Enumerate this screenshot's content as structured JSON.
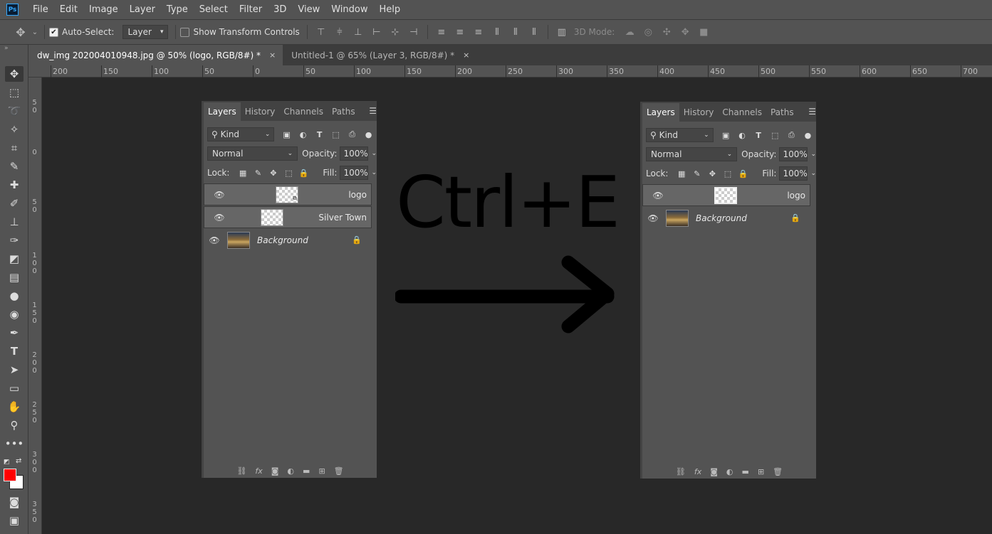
{
  "app": {
    "logo": "Ps"
  },
  "menu": [
    "File",
    "Edit",
    "Image",
    "Layer",
    "Type",
    "Select",
    "Filter",
    "3D",
    "View",
    "Window",
    "Help"
  ],
  "options": {
    "auto_select_label": "Auto-Select:",
    "auto_select_checked": true,
    "auto_select_value": "Layer",
    "show_transform_label": "Show Transform Controls",
    "show_transform_checked": false,
    "mode_3d_label": "3D Mode:"
  },
  "tabs": [
    {
      "title": "dw_img 202004010948.jpg @ 50% (logo, RGB/8#) *",
      "active": true,
      "close": "×"
    },
    {
      "title": "Untitled-1 @ 65% (Layer 3, RGB/8#) *",
      "active": false,
      "close": "×"
    }
  ],
  "ruler_top": [
    "200",
    "150",
    "100",
    "50",
    "0",
    "50",
    "100",
    "150",
    "200",
    "250",
    "300",
    "350",
    "400",
    "450",
    "500",
    "550",
    "600",
    "650",
    "700"
  ],
  "ruler_left": [
    "5\n0",
    "0",
    "5\n0",
    "1\n0\n0",
    "1\n5\n0",
    "2\n0\n0",
    "2\n5\n0",
    "3\n0\n0",
    "3\n5\n0"
  ],
  "colors": {
    "foreground": "#ff0000",
    "background": "#ffffff",
    "accent": "#31a8ff"
  },
  "canvas": {
    "shortcut_text": "Ctrl+E"
  },
  "panel_left": {
    "tabs": [
      "Layers",
      "History",
      "Channels",
      "Paths"
    ],
    "kind": "Kind",
    "blend_mode": "Normal",
    "opacity_label": "Opacity:",
    "opacity": "100%",
    "lock_label": "Lock:",
    "fill_label": "Fill:",
    "fill": "100%",
    "layers": [
      {
        "name": "logo",
        "selected": true,
        "thumb": "transparent-smart",
        "italic": false,
        "locked": false
      },
      {
        "name": "Silver Town",
        "selected": true,
        "thumb": "transparent",
        "italic": false,
        "locked": false
      },
      {
        "name": "Background",
        "selected": false,
        "thumb": "photo",
        "italic": true,
        "locked": true
      }
    ]
  },
  "panel_right": {
    "tabs": [
      "Layers",
      "History",
      "Channels",
      "Paths"
    ],
    "kind": "Kind",
    "blend_mode": "Normal",
    "opacity_label": "Opacity:",
    "opacity": "100%",
    "lock_label": "Lock:",
    "fill_label": "Fill:",
    "fill": "100%",
    "layers": [
      {
        "name": "logo",
        "selected": true,
        "thumb": "transparent-outlined",
        "italic": false,
        "locked": false
      },
      {
        "name": "Background",
        "selected": false,
        "thumb": "photo",
        "italic": true,
        "locked": true
      }
    ]
  }
}
